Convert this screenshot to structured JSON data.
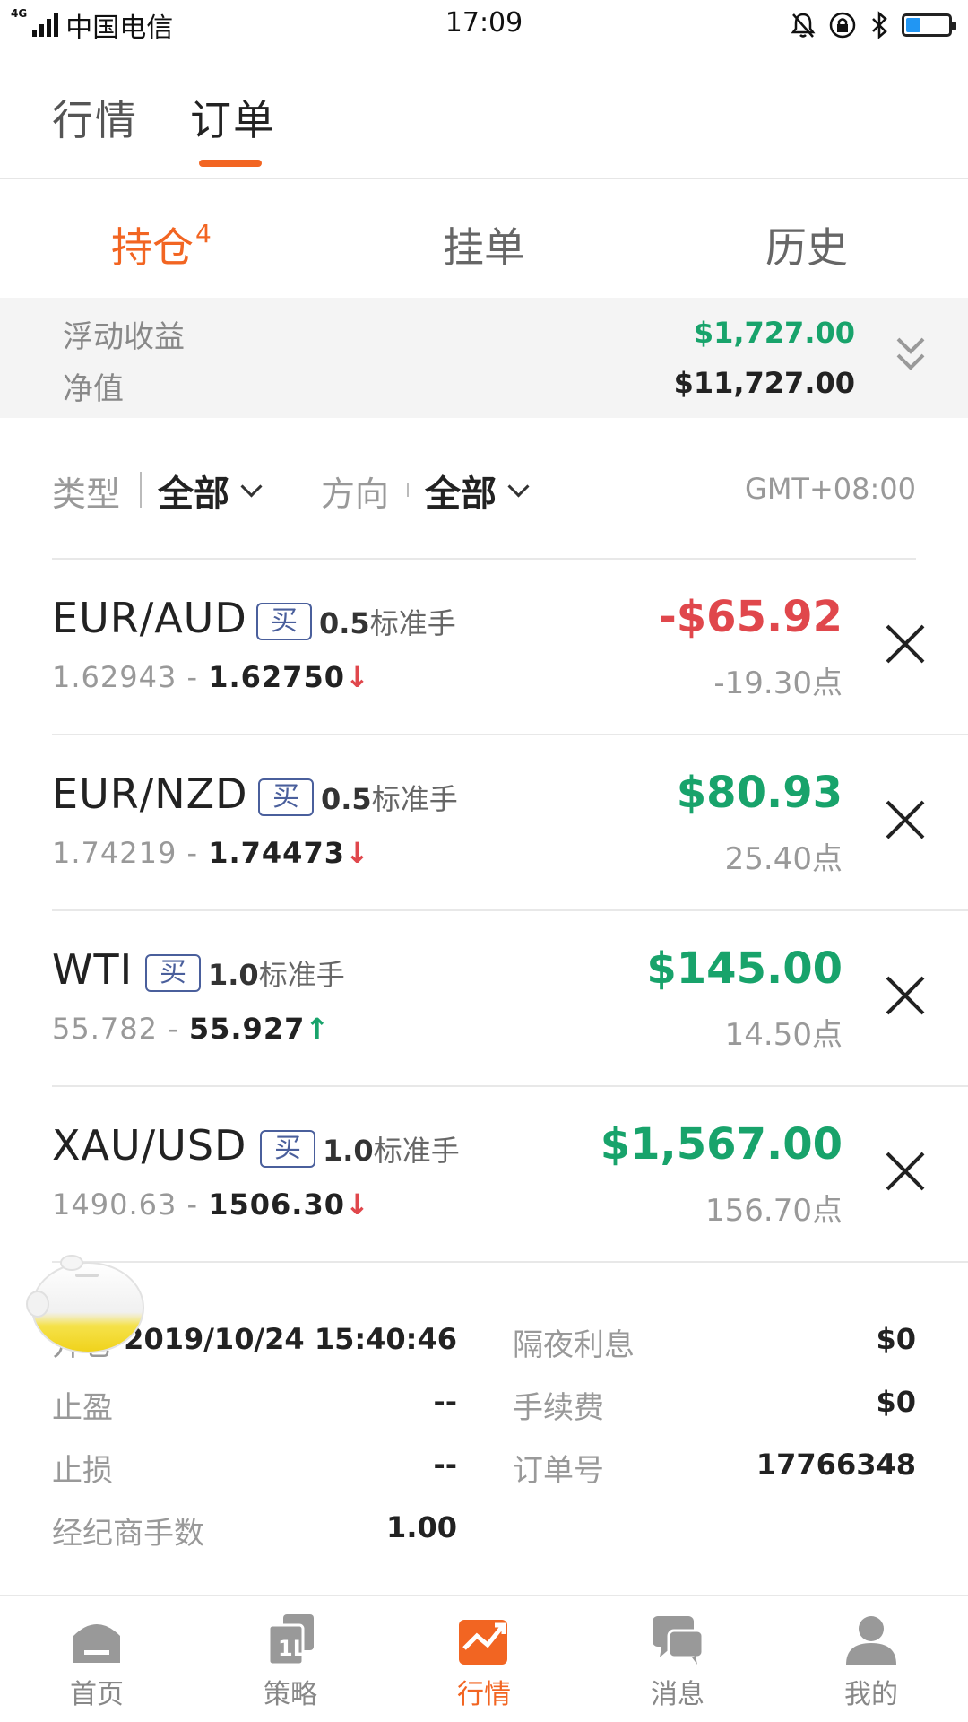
{
  "status_bar": {
    "network": "4G",
    "carrier": "中国电信",
    "time": "17:09",
    "icons": [
      "mute-icon",
      "lock-rotation-icon",
      "bluetooth-icon",
      "battery-icon"
    ],
    "battery_level": 0.35
  },
  "top_tabs": [
    {
      "label": "行情",
      "active": false
    },
    {
      "label": "订单",
      "active": true
    }
  ],
  "sub_tabs": [
    {
      "label": "持仓",
      "count": "4",
      "active": true
    },
    {
      "label": "挂单",
      "active": false
    },
    {
      "label": "历史",
      "active": false
    }
  ],
  "summary": {
    "floating_label": "浮动收益",
    "floating_value": "$1,727.00",
    "equity_label": "净值",
    "equity_value": "$11,727.00"
  },
  "filters": {
    "type_label": "类型",
    "type_value": "全部",
    "direction_label": "方向",
    "direction_value": "全部",
    "timezone": "GMT+08:00"
  },
  "positions": [
    {
      "symbol": "EUR/AUD",
      "side": "买",
      "lots": "0.5",
      "lots_unit": "标准手",
      "open_price": "1.62943",
      "current_price": "1.62750",
      "trend": "↓",
      "pnl": "-$65.92",
      "points": "-19.30点"
    },
    {
      "symbol": "EUR/NZD",
      "side": "买",
      "lots": "0.5",
      "lots_unit": "标准手",
      "open_price": "1.74219",
      "current_price": "1.74473",
      "trend": "↓",
      "pnl": "$80.93",
      "points": "25.40点"
    },
    {
      "symbol": "WTI",
      "side": "买",
      "lots": "1.0",
      "lots_unit": "标准手",
      "open_price": "55.782",
      "current_price": "55.927",
      "trend": "↑",
      "pnl": "$145.00",
      "points": "14.50点"
    },
    {
      "symbol": "XAU/USD",
      "side": "买",
      "lots": "1.0",
      "lots_unit": "标准手",
      "open_price": "1490.63",
      "current_price": "1506.30",
      "trend": "↓",
      "pnl": "$1,567.00",
      "points": "156.70点"
    }
  ],
  "detail": {
    "open_label": "开仓",
    "open_value": "2019/10/24 15:40:46",
    "overnight_label": "隔夜利息",
    "overnight_value": "$0",
    "tp_label": "止盈",
    "tp_value": "--",
    "fee_label": "手续费",
    "fee_value": "$0",
    "sl_label": "止损",
    "sl_value": "--",
    "order_label": "订单号",
    "order_value": "17766348",
    "broker_lots_label": "经纪商手数",
    "broker_lots_value": "1.00"
  },
  "bottom_nav": [
    {
      "label": "首页",
      "icon": "home-icon",
      "active": false
    },
    {
      "label": "策略",
      "icon": "strategy-icon",
      "active": false
    },
    {
      "label": "行情",
      "icon": "market-chart-icon",
      "active": true
    },
    {
      "label": "消息",
      "icon": "message-icon",
      "active": false
    },
    {
      "label": "我的",
      "icon": "profile-icon",
      "active": false
    }
  ],
  "colors": {
    "accent": "#f26522",
    "profit": "#18a36b",
    "loss": "#e0474c",
    "badge": "#4a5f9c"
  }
}
